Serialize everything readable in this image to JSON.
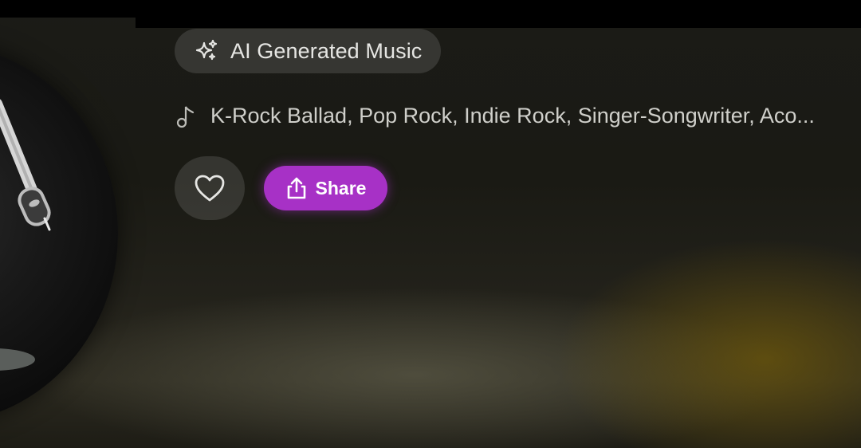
{
  "chip": {
    "icon": "sparkles-icon",
    "label": "AI Generated Music"
  },
  "genres": {
    "icon": "music-note-icon",
    "text": "K-Rock Ballad, Pop Rock, Indie Rock, Singer-Songwriter, Aco..."
  },
  "actions": {
    "like_icon": "heart-icon",
    "share_icon": "share-icon",
    "share_label": "Share"
  },
  "colors": {
    "share_accent": "#a731c6",
    "chip_bg": "rgba(255,255,255,0.12)",
    "text_primary": "#e6e6e3",
    "text_secondary": "#cfcfca"
  }
}
